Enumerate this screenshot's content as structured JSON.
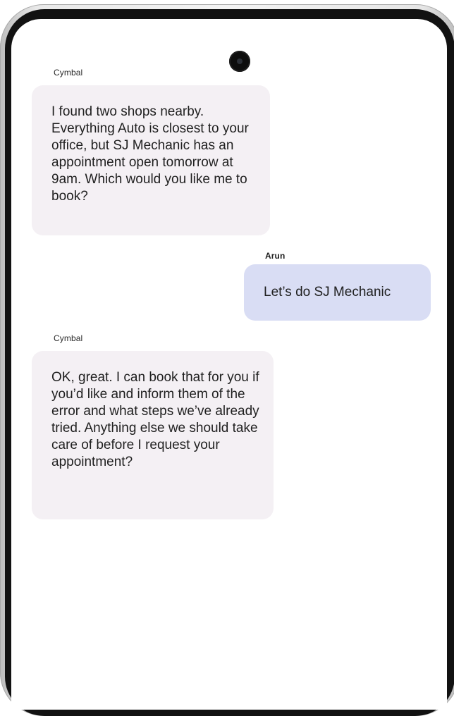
{
  "conversation": {
    "messages": [
      {
        "sender": "Cymbal",
        "role": "assistant",
        "text": "I found two shops nearby. Everything Auto is closest to your office, but SJ Mechanic has an appointment open tomorrow at 9am. Which would you like me to book?"
      },
      {
        "sender": "Arun",
        "role": "user",
        "text": "Let’s do SJ Mechanic"
      },
      {
        "sender": "Cymbal",
        "role": "assistant",
        "text": "OK, great. I can book that for you if you’d like and inform them of the error and what steps we’ve already tried. Anything else we should take care of before I request your appointment?"
      }
    ]
  },
  "icons": {
    "camera": "front-camera-icon"
  },
  "colors": {
    "assistant_bubble": "#f4f0f4",
    "user_bubble": "#d9ddf4",
    "text": "#1f1f1f",
    "bezel": "#121212"
  }
}
